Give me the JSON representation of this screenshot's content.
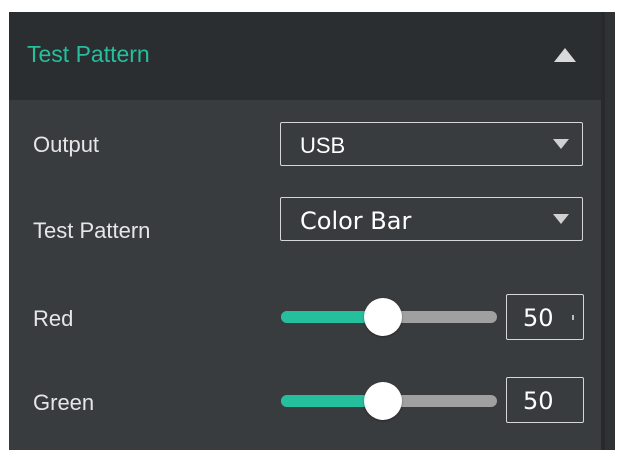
{
  "panel": {
    "title": "Test Pattern",
    "collapse_icon": "triangle-up-icon",
    "colors": {
      "title": "#25bf9d",
      "accent": "#25bf9d",
      "panel_background": "#393c3f",
      "header_background": "#2b2e31"
    }
  },
  "settings": {
    "output": {
      "label": "Output",
      "value": "USB",
      "icon": "triangle-down-icon"
    },
    "test_pattern": {
      "label": "Test Pattern",
      "value": "Color Bar",
      "icon": "triangle-down-icon"
    },
    "red": {
      "label": "Red",
      "value": "50",
      "slider_fraction": 0.47
    },
    "green": {
      "label": "Green",
      "value": "50",
      "slider_fraction": 0.47
    }
  }
}
